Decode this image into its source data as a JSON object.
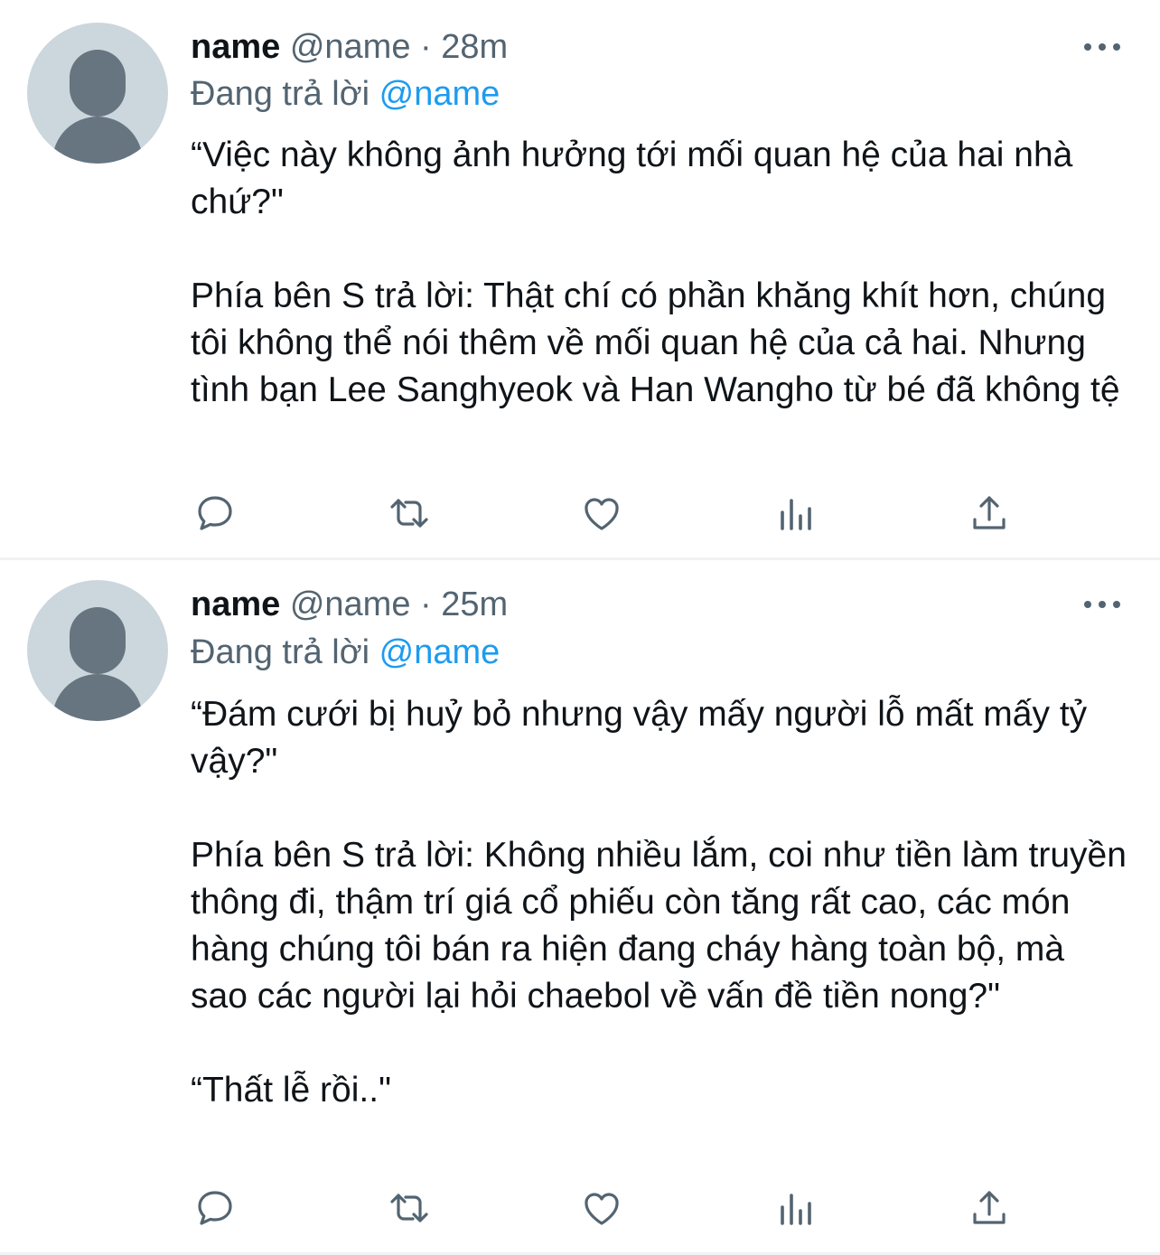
{
  "tweets": [
    {
      "author_name": "name",
      "handle": "@name",
      "separator": "·",
      "time": "28m",
      "reply_prefix": "Đang trả lời",
      "reply_to": "@name",
      "paragraphs": [
        "“Việc này không ảnh hưởng tới mối quan hệ của hai nhà chứ?\"",
        "Phía bên S trả lời: Thật chí có phần khăng khít hơn, chúng tôi không thể nói thêm về mối quan hệ của cả hai. Nhưng tình bạn Lee Sanghyeok và Han Wangho từ bé đã không tệ"
      ]
    },
    {
      "author_name": "name",
      "handle": "@name",
      "separator": "·",
      "time": "25m",
      "reply_prefix": "Đang trả lời",
      "reply_to": "@name",
      "paragraphs": [
        "“Đám cưới bị huỷ bỏ nhưng vậy mấy người lỗ mất mấy tỷ vậy?\"",
        "Phía bên S trả lời: Không nhiều lắm, coi như tiền làm truyền thông đi, thậm trí giá cổ phiếu còn tăng rất cao, các món hàng chúng tôi bán ra hiện đang cháy hàng toàn bộ, mà sao các người lại hỏi chaebol về vấn đề tiền nong?\"",
        "“Thất lễ rồi..\""
      ]
    }
  ],
  "icons": [
    "reply-icon",
    "retweet-icon",
    "like-icon",
    "stats-icon",
    "share-icon",
    "more-icon"
  ],
  "colors": {
    "text": "#0f1419",
    "secondary": "#536471",
    "link": "#1d9bf0",
    "divider": "#eff3f4",
    "avatar_bg": "#ccd6dd",
    "avatar_fg": "#66757f"
  }
}
